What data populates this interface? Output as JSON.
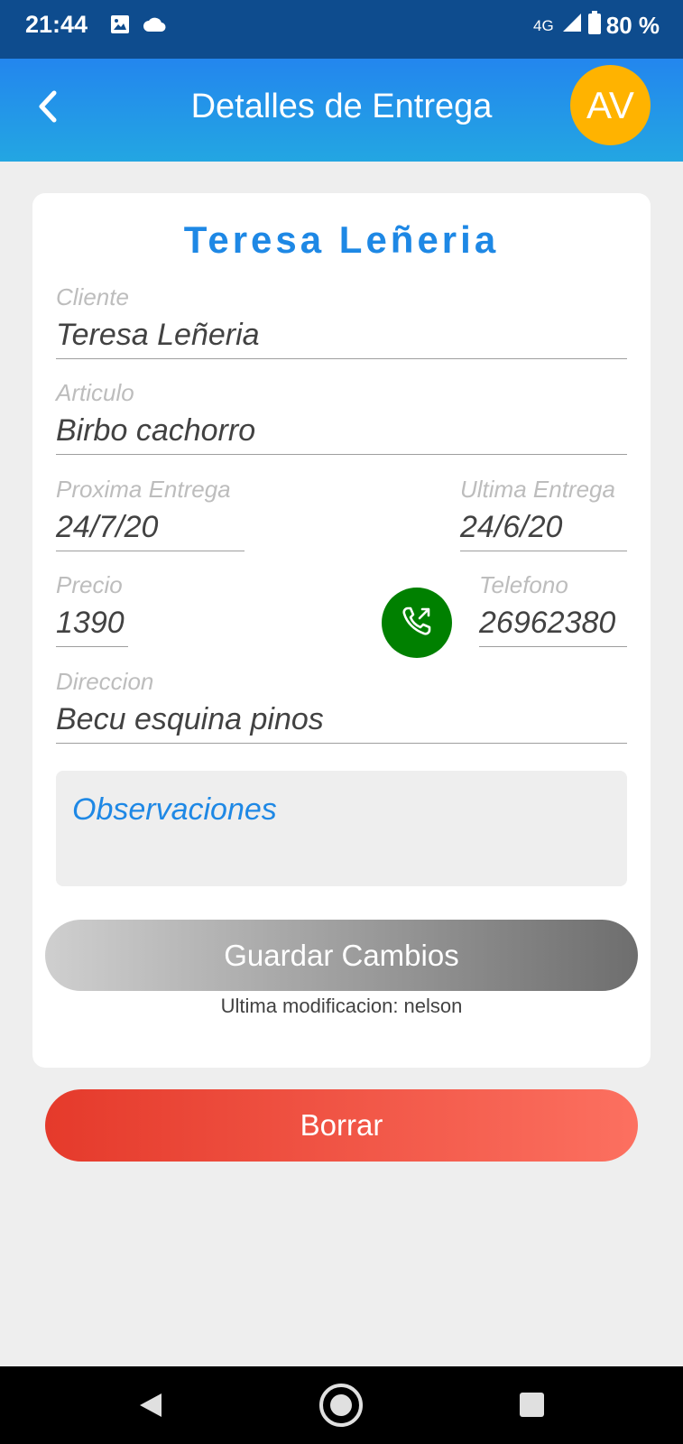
{
  "status_bar": {
    "time": "21:44",
    "network": "4G",
    "battery": "80 %",
    "icons": [
      "image-icon",
      "cloud-icon",
      "signal-icon",
      "battery-icon"
    ]
  },
  "app_bar": {
    "title": "Detalles de Entrega",
    "avatar_initials": "AV",
    "back_icon": "chevron-left-icon"
  },
  "card": {
    "title": "Teresa Leñeria",
    "cliente": {
      "label": "Cliente",
      "value": "Teresa Leñeria"
    },
    "articulo": {
      "label": "Articulo",
      "value": "Birbo cachorro"
    },
    "proxima_entrega": {
      "label": "Proxima Entrega",
      "value": "24/7/20"
    },
    "ultima_entrega": {
      "label": "Ultima Entrega",
      "value": "24/6/20"
    },
    "precio": {
      "label": "Precio",
      "value": "1390"
    },
    "telefono": {
      "label": "Telefono",
      "value": "26962380"
    },
    "direccion": {
      "label": "Direccion",
      "value": "Becu esquina pinos"
    },
    "observaciones": {
      "placeholder": "Observaciones"
    },
    "save_label": "Guardar Cambios",
    "last_modified": "Ultima modificacion: nelson"
  },
  "delete_label": "Borrar",
  "colors": {
    "status_bar": "#0e4c8e",
    "app_bar_top": "#2386ee",
    "app_bar_bottom": "#23a6e2",
    "accent": "#1e88e5",
    "avatar": "#ffb300",
    "call_button": "#008000",
    "delete_start": "#e53a2b",
    "delete_end": "#fc7060"
  }
}
